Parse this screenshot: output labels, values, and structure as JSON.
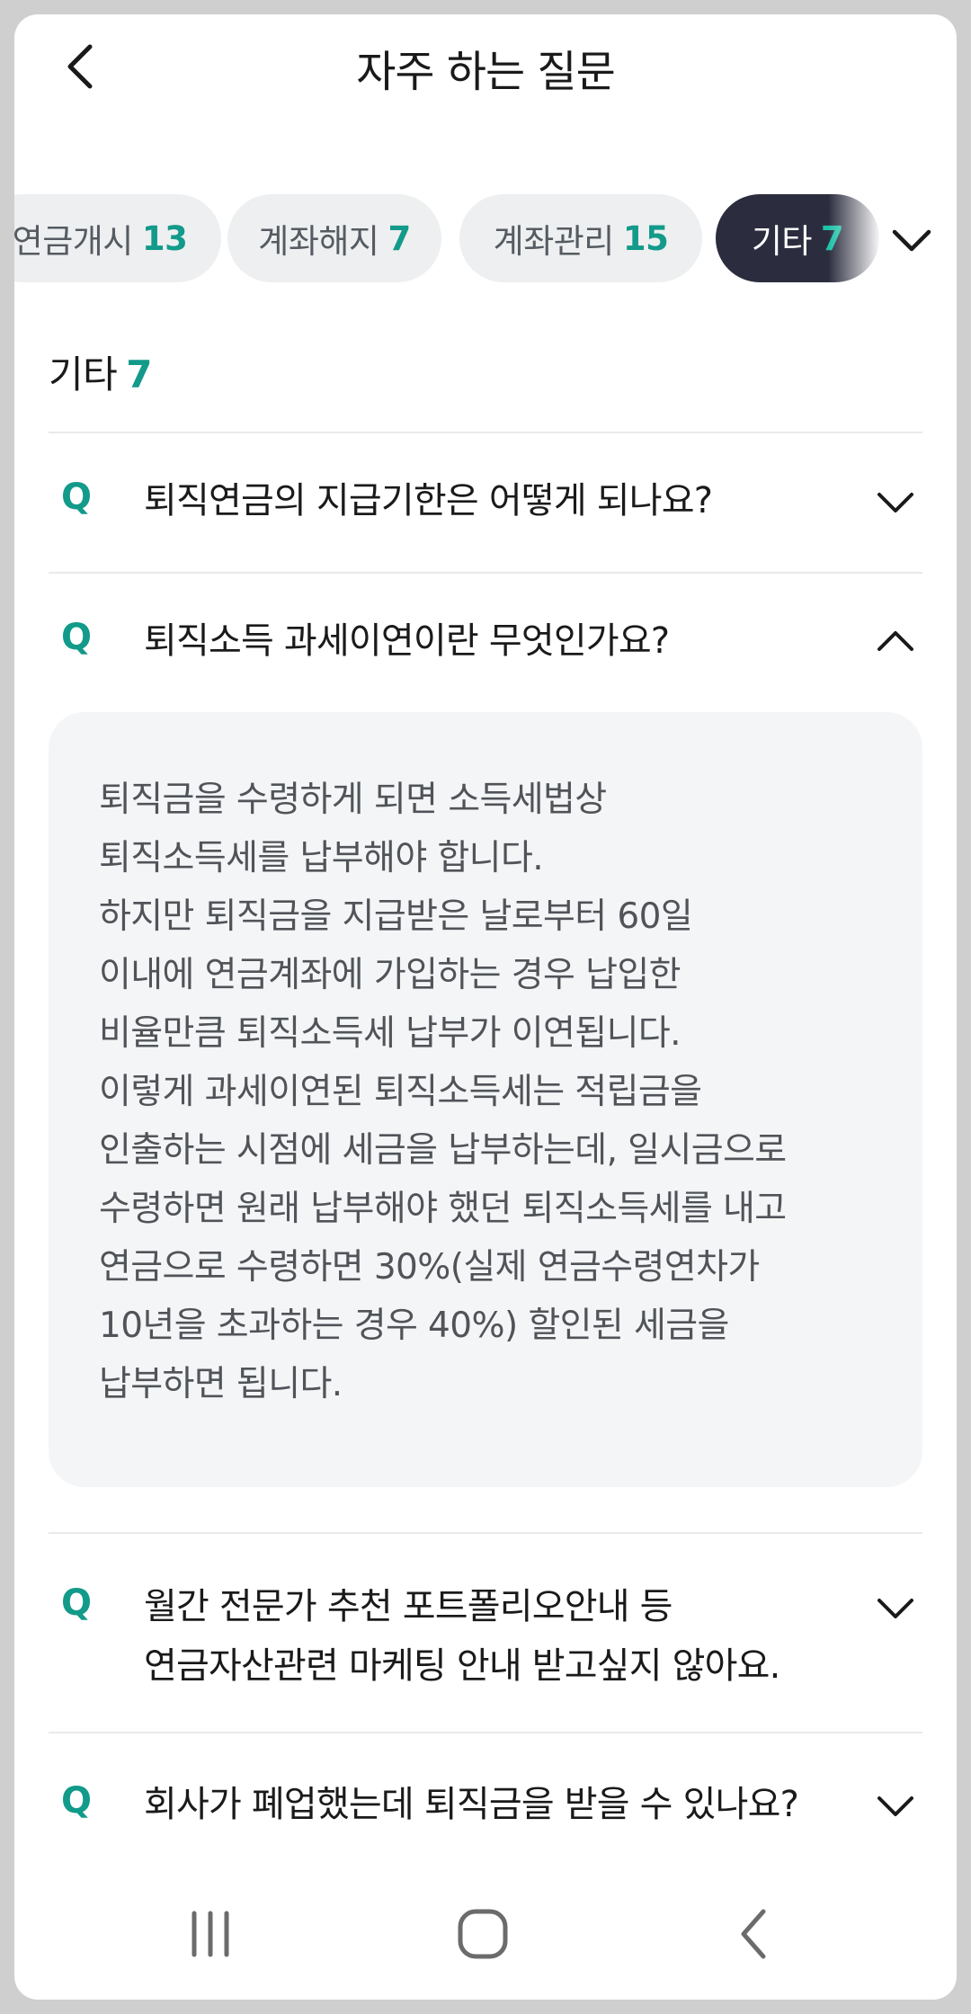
{
  "header": {
    "title": "자주 하는 질문",
    "back_icon": "chevron-left-icon"
  },
  "chips": [
    {
      "label": "연금개시",
      "count": "13",
      "active": false
    },
    {
      "label": "계좌해지",
      "count": "7",
      "active": false
    },
    {
      "label": "계좌관리",
      "count": "15",
      "active": false
    },
    {
      "label": "기타",
      "count": "7",
      "active": true
    }
  ],
  "section": {
    "title": "기타",
    "count": "7"
  },
  "faq": [
    {
      "q": "Q",
      "lines": [
        "퇴직연금의 지급기한은 어떻게 되나요?"
      ],
      "expanded": false
    },
    {
      "q": "Q",
      "lines": [
        "퇴직소득 과세이연이란 무엇인가요?"
      ],
      "expanded": true
    },
    {
      "q": "Q",
      "lines": [
        "월간 전문가 추천 포트폴리오안내 등",
        "연금자산관련 마케팅 안내 받고싶지 않아요."
      ],
      "expanded": false
    },
    {
      "q": "Q",
      "lines": [
        "회사가 폐업했는데 퇴직금을 받을 수 있나요?"
      ],
      "expanded": false
    }
  ],
  "answer": {
    "lines": [
      "퇴직금을 수령하게 되면 소득세법상",
      "퇴직소득세를 납부해야 합니다.",
      "하지만 퇴직금을 지급받은 날로부터 60일",
      "이내에 연금계좌에 가입하는 경우 납입한",
      "비율만큼 퇴직소득세 납부가 이연됩니다.",
      "이렇게 과세이연된 퇴직소득세는 적립금을",
      "인출하는 시점에 세금을 납부하는데, 일시금으로",
      "수령하면 원래 납부해야 했던 퇴직소득세를 내고",
      "연금으로 수령하면 30%(실제 연금수령연차가",
      "10년을 초과하는 경우 40%) 할인된 세금을",
      "납부하면 됩니다."
    ]
  },
  "navbar": {
    "icons": [
      "recent-apps-icon",
      "home-icon",
      "back-icon"
    ]
  },
  "colors": {
    "accent": "#129a8a",
    "active_chip": "#2b2d3e",
    "answer_bg": "#f4f5f6"
  }
}
